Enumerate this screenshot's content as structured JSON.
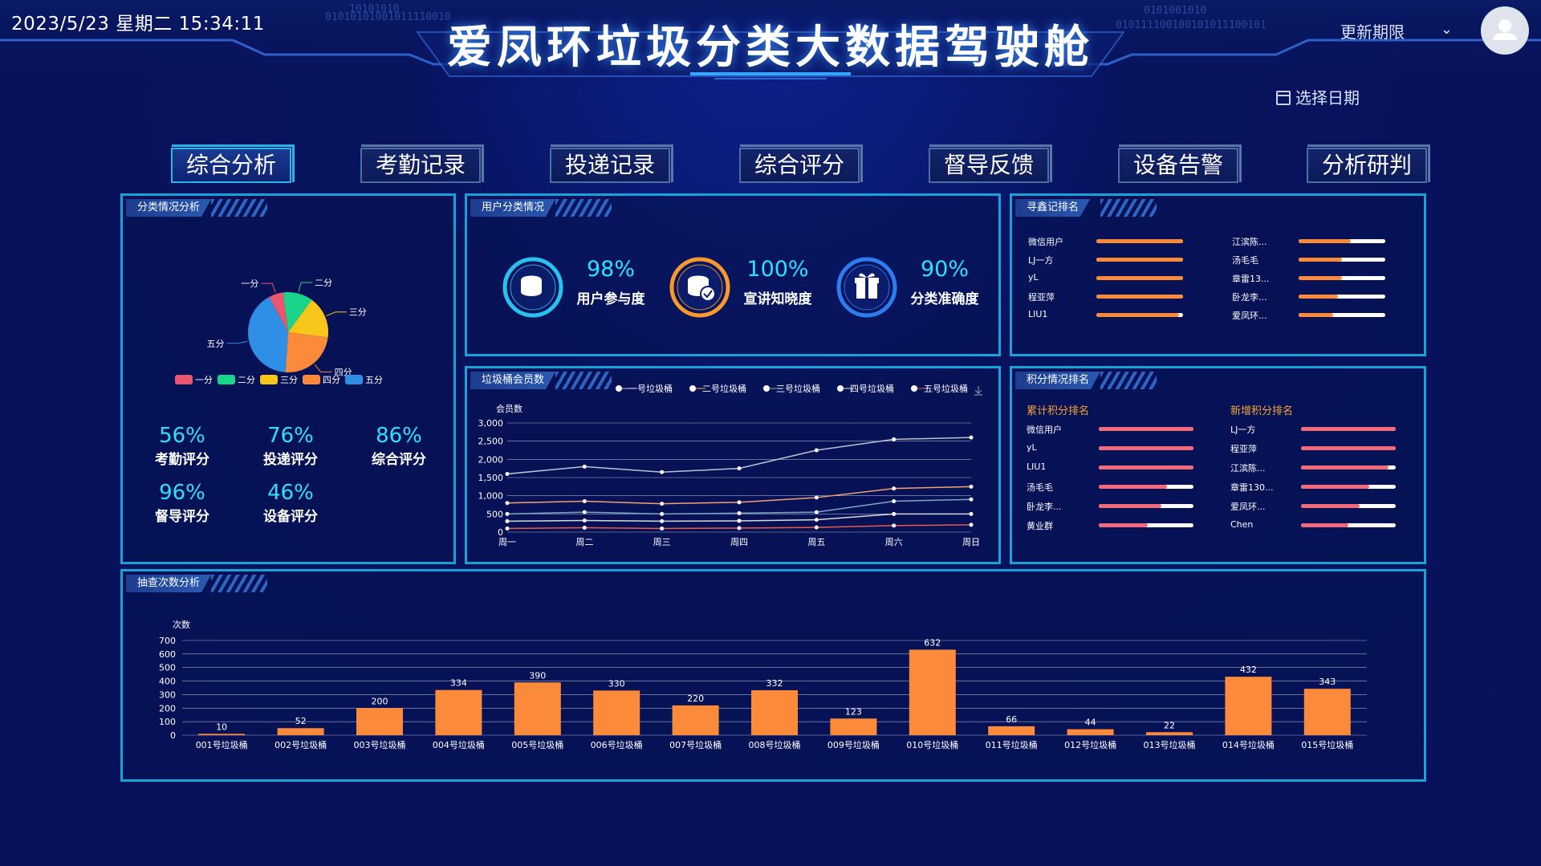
{
  "header": {
    "datetime": "2023/5/23 星期二 15:34:11",
    "title": "爱凤环垃圾分类大数据驾驶舱",
    "binary_left": "01010101001011110010",
    "binary_right": "010111100100101011100101",
    "binary_right2": "0101001010",
    "binary_left2": "10101010",
    "update_label": "更新期限",
    "date_picker_label": "选择日期"
  },
  "tabs": [
    "综合分析",
    "考勤记录",
    "投递记录",
    "综合评分",
    "督导反馈",
    "设备告警",
    "分析研判"
  ],
  "active_tab": 0,
  "panels": {
    "classification": {
      "title": "分类情况分析",
      "pie": {
        "slices": [
          {
            "label": "一分",
            "value": 6,
            "color": "#e9566f"
          },
          {
            "label": "二分",
            "value": 12,
            "color": "#19d58a"
          },
          {
            "label": "三分",
            "value": 17,
            "color": "#f7c619"
          },
          {
            "label": "四分",
            "value": 24,
            "color": "#fb8a3a"
          },
          {
            "label": "五分",
            "value": 41,
            "color": "#2f8fe6"
          }
        ]
      },
      "scores": [
        {
          "value": "56%",
          "label": "考勤评分"
        },
        {
          "value": "76%",
          "label": "投递评分"
        },
        {
          "value": "86%",
          "label": "综合评分"
        },
        {
          "value": "96%",
          "label": "督导评分"
        },
        {
          "value": "46%",
          "label": "设备评分"
        }
      ]
    },
    "user_classification": {
      "title": "用户分类情况",
      "items": [
        {
          "value": "98%",
          "label": "用户参与度",
          "ring_color": "#27c2f0",
          "icon": "coins-stack-icon"
        },
        {
          "value": "100%",
          "label": "宣讲知晓度",
          "ring_color": "#f89a2b",
          "icon": "coins-check-icon"
        },
        {
          "value": "90%",
          "label": "分类准确度",
          "ring_color": "#2c7ef0",
          "icon": "gift-icon"
        }
      ]
    },
    "seek_rank": {
      "title": "寻鑫记排名",
      "left": [
        {
          "name": "微信用户",
          "fill": 1.0
        },
        {
          "name": "LJ一方",
          "fill": 1.0
        },
        {
          "name": "yL",
          "fill": 1.0
        },
        {
          "name": "程亚萍",
          "fill": 1.0
        },
        {
          "name": "LIU1",
          "fill": 0.95
        }
      ],
      "right": [
        {
          "name": "江滨陈...",
          "fill": 0.6
        },
        {
          "name": "汤毛毛",
          "fill": 0.5
        },
        {
          "name": "章雷13...",
          "fill": 0.5
        },
        {
          "name": "卧龙李...",
          "fill": 0.45
        },
        {
          "name": "爱凤环...",
          "fill": 0.4
        }
      ],
      "bar_color": "#fb8a3a"
    },
    "bin_members": {
      "title": "垃圾桶会员数",
      "legend": [
        "一号垃圾桶",
        "二号垃圾桶",
        "三号垃圾桶",
        "四号垃圾桶",
        "五号垃圾桶"
      ],
      "download_icon": "download-icon"
    },
    "points_rank": {
      "title": "积分情况排名",
      "left_title": "累计积分排名",
      "right_title": "新增积分排名",
      "left": [
        {
          "name": "微信用户",
          "fill": 1.0
        },
        {
          "name": "yL",
          "fill": 1.0
        },
        {
          "name": "LIU1",
          "fill": 1.0
        },
        {
          "name": "汤毛毛",
          "fill": 0.72
        },
        {
          "name": "卧龙李...",
          "fill": 0.66
        },
        {
          "name": "黄业群",
          "fill": 0.52
        }
      ],
      "right": [
        {
          "name": "LJ一方",
          "fill": 1.0
        },
        {
          "name": "程亚萍",
          "fill": 1.0
        },
        {
          "name": "江滨陈...",
          "fill": 0.92
        },
        {
          "name": "章雷130...",
          "fill": 0.72
        },
        {
          "name": "爱凤环...",
          "fill": 0.62
        },
        {
          "name": "Chen",
          "fill": 0.5
        }
      ],
      "bar_color": "#f2697a"
    },
    "inspection": {
      "title": "抽查次数分析"
    }
  },
  "chart_data": [
    {
      "type": "line",
      "ylabel": "会员数",
      "x": [
        "周一",
        "周二",
        "周三",
        "周四",
        "周五",
        "周六",
        "周日"
      ],
      "ylim": [
        0,
        3000
      ],
      "yticks": [
        "3,000",
        "2,500",
        "2,000",
        "1,500",
        "1,000",
        "500",
        "0"
      ],
      "ytick_values": [
        3000,
        2500,
        2000,
        1500,
        1000,
        500,
        0
      ],
      "grid": true,
      "legend_position": "top",
      "series": [
        {
          "name": "一号垃圾桶",
          "color": "#b7c4cf",
          "values": [
            1600,
            1800,
            1650,
            1750,
            2250,
            2550,
            2600
          ]
        },
        {
          "name": "二号垃圾桶",
          "color": "#f3a071",
          "values": [
            800,
            850,
            780,
            820,
            950,
            1200,
            1250
          ]
        },
        {
          "name": "三号垃圾桶",
          "color": "#7fa6c3",
          "values": [
            500,
            550,
            500,
            520,
            550,
            850,
            900
          ]
        },
        {
          "name": "四号垃圾桶",
          "color": "#d9d9d9",
          "values": [
            300,
            320,
            300,
            310,
            340,
            500,
            500
          ]
        },
        {
          "name": "五号垃圾桶",
          "color": "#e85a4f",
          "values": [
            100,
            120,
            100,
            110,
            130,
            180,
            200
          ]
        }
      ]
    },
    {
      "type": "bar",
      "ylabel": "次数",
      "categories": [
        "001号垃圾桶",
        "002号垃圾桶",
        "003号垃圾桶",
        "004号垃圾桶",
        "005号垃圾桶",
        "006号垃圾桶",
        "007号垃圾桶",
        "008号垃圾桶",
        "009号垃圾桶",
        "010号垃圾桶",
        "011号垃圾桶",
        "012号垃圾桶",
        "013号垃圾桶",
        "014号垃圾桶",
        "015号垃圾桶"
      ],
      "values": [
        10,
        52,
        200,
        334,
        390,
        330,
        220,
        332,
        123,
        632,
        66,
        44,
        22,
        432,
        343
      ],
      "ylim": [
        0,
        700
      ],
      "yticks": [
        "700",
        "600",
        "500",
        "400",
        "300",
        "200",
        "100",
        "0"
      ],
      "ytick_values": [
        700,
        600,
        500,
        400,
        300,
        200,
        100,
        0
      ],
      "grid": true,
      "color": "#fb8a3a"
    }
  ]
}
